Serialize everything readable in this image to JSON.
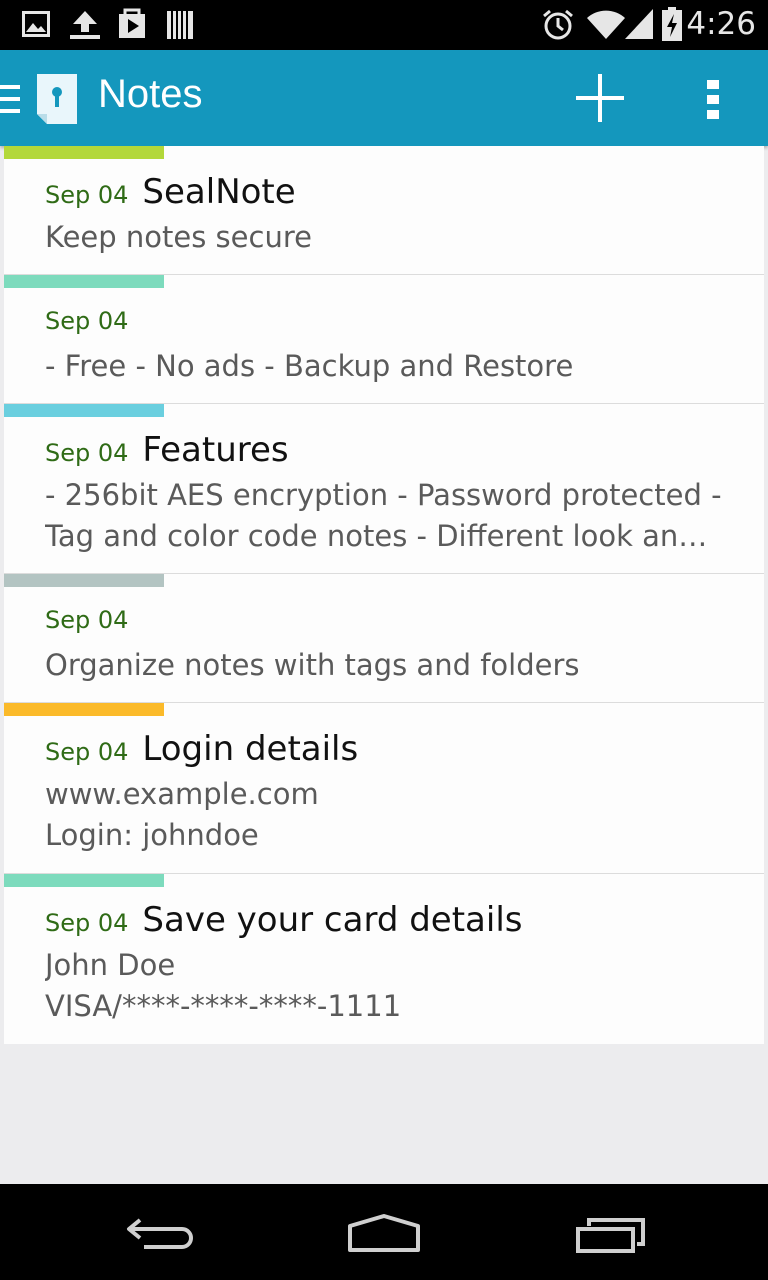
{
  "status_bar": {
    "time": "4:26",
    "left_icons": [
      "image-icon",
      "upload-icon",
      "play-store-icon",
      "barcode-icon"
    ],
    "right_icons": [
      "alarm-icon",
      "wifi-icon",
      "signal-icon",
      "battery-charging-icon"
    ]
  },
  "action_bar": {
    "title": "Notes",
    "app_icon": "sealnote-key-icon",
    "actions": [
      "add-icon",
      "overflow-menu-icon"
    ]
  },
  "notes": [
    {
      "date": "Sep 04",
      "title": "SealNote",
      "lines": [
        "Keep notes secure"
      ],
      "color": "#b3d83a"
    },
    {
      "date": "Sep 04",
      "title": "",
      "lines": [
        "- Free - No ads - Backup and Restore"
      ],
      "color": "#7ddbbd"
    },
    {
      "date": "Sep 04",
      "title": "Features",
      "lines": [
        "- 256bit AES encryption - Password protected -",
        "Tag and color code notes - Different look and…"
      ],
      "color": "#6acfdf"
    },
    {
      "date": "Sep 04",
      "title": "",
      "lines": [
        "Organize notes with tags and folders"
      ],
      "color": "#b3c4c2"
    },
    {
      "date": "Sep 04",
      "title": "Login details",
      "lines": [
        "www.example.com",
        "Login: johndoe"
      ],
      "color": "#fbba2a"
    },
    {
      "date": "Sep 04",
      "title": "Save your card details",
      "lines": [
        "John Doe",
        "VISA/****-****-****-1111"
      ],
      "color": "#7ddbbd"
    }
  ],
  "nav_bar": [
    "back-icon",
    "home-icon",
    "recents-icon"
  ]
}
